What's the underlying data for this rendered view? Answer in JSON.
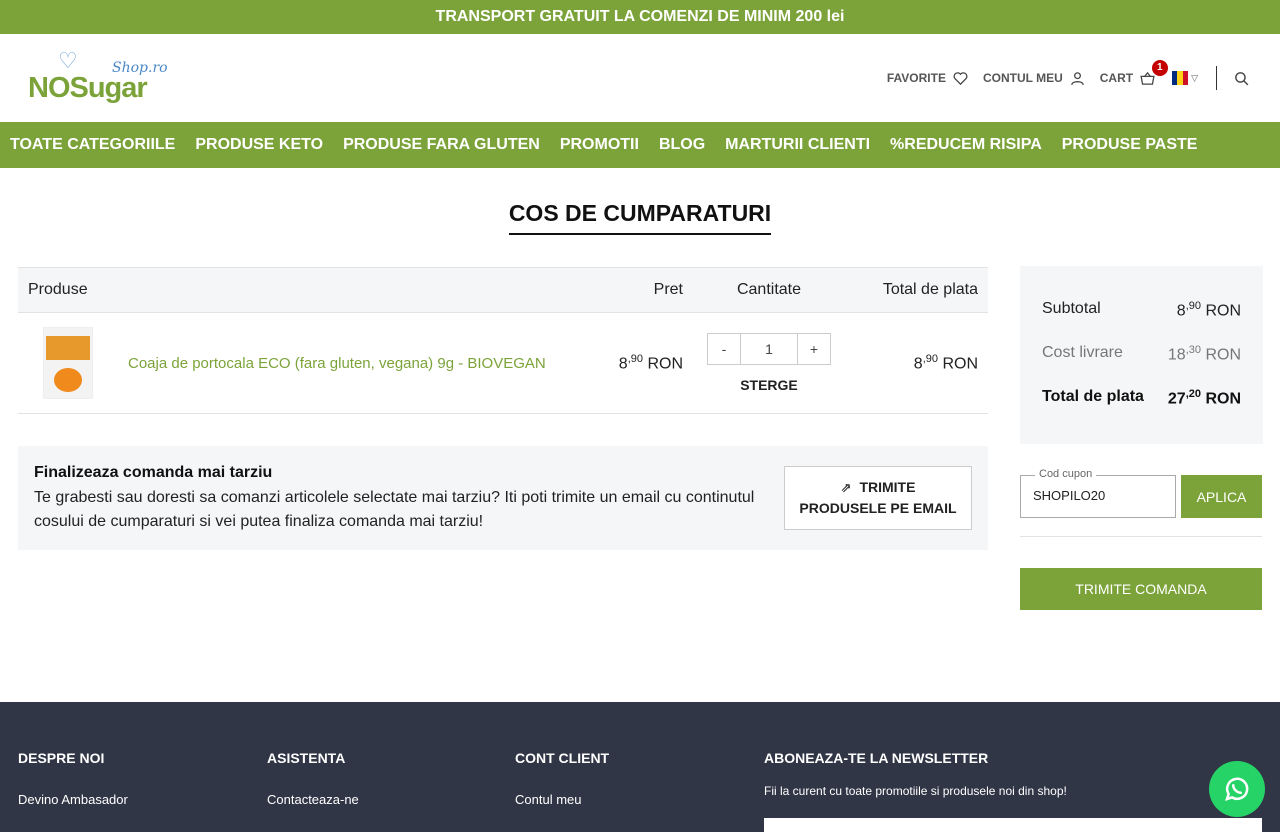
{
  "topbar": {
    "text": "TRANSPORT GRATUIT LA COMENZI DE MINIM 200 lei"
  },
  "logo": {
    "brand": "NOSugar",
    "suffix": "Shop.ro"
  },
  "header": {
    "favorite": "FAVORITE",
    "account": "CONTUL MEU",
    "cart": "CART",
    "cart_count": "1",
    "language_flag": "ro-flag-icon"
  },
  "nav": {
    "items": [
      "TOATE CATEGORIILE",
      "PRODUSE KETO",
      "PRODUSE FARA GLUTEN",
      "PROMOTII",
      "BLOG",
      "MARTURII CLIENTI",
      "%REDUCEM RISIPA",
      "PRODUSE PASTE"
    ]
  },
  "page": {
    "title": "COS DE CUMPARATURI"
  },
  "cart_table": {
    "headers": {
      "product": "Produse",
      "price": "Pret",
      "qty": "Cantitate",
      "total": "Total de plata"
    },
    "items": [
      {
        "name": "Coaja de portocala ECO (fara gluten, vegana) 9g - BIOVEGAN",
        "price_int": "8",
        "price_dec": ",90",
        "currency": "RON",
        "qty": "1",
        "minus": "-",
        "plus": "+",
        "remove": "STERGE",
        "total_int": "8",
        "total_dec": ",90"
      }
    ]
  },
  "later": {
    "title": "Finalizeaza comanda mai tarziu",
    "text": "Te grabesti sau doresti sa comanzi articolele selectate mai tarziu? Iti poti trimite un email cu continutul cosului de cumparaturi si vei putea finaliza comanda mai tarziu!",
    "button_line1": "TRIMITE",
    "button_line2": "PRODUSELE PE EMAIL"
  },
  "summary": {
    "subtotal_label": "Subtotal",
    "subtotal_int": "8",
    "subtotal_dec": ",90",
    "shipping_label": "Cost livrare",
    "shipping_int": "18",
    "shipping_dec": ",30",
    "total_label": "Total de plata",
    "total_int": "27",
    "total_dec": ",20",
    "currency": "RON"
  },
  "coupon": {
    "label": "Cod cupon",
    "value": "SHOPILO20",
    "apply": "APLICA"
  },
  "submit": {
    "label": "TRIMITE COMANDA"
  },
  "footer": {
    "col1": {
      "title": "DESPRE NOI",
      "link1": "Devino Ambasador"
    },
    "col2": {
      "title": "ASISTENTA",
      "link1": "Contacteaza-ne"
    },
    "col3": {
      "title": "CONT CLIENT",
      "link1": "Contul meu"
    },
    "col4": {
      "title": "ABONEAZA-TE LA NEWSLETTER",
      "text": "Fii la curent cu toate promotiile si produsele noi din shop!"
    }
  },
  "colors": {
    "brand_green": "#7ca33a",
    "footer_bg": "#313646",
    "badge_red": "#c40000",
    "whatsapp": "#25d366"
  }
}
